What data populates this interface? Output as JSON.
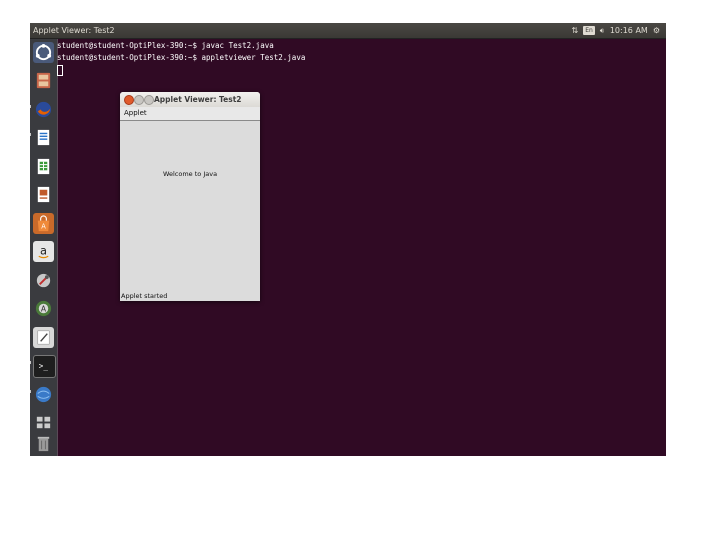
{
  "topbar": {
    "title": "Applet Viewer: Test2",
    "network_icon": "network-updown-icon",
    "keyboard_label": "En",
    "volume_icon": "speaker-volume-icon",
    "clock": "10:16 AM",
    "gear_icon": "gear-icon"
  },
  "launcher": {
    "items": [
      {
        "name": "dash-home",
        "icon": "ubuntu-logo-icon",
        "color": "#4a7bd6"
      },
      {
        "name": "files",
        "icon": "file-cabinet-icon",
        "color": "#c8664a"
      },
      {
        "name": "firefox",
        "icon": "firefox-icon",
        "color": "#e66000"
      },
      {
        "name": "writer",
        "icon": "document-icon",
        "color": "#2a74c9"
      },
      {
        "name": "calc",
        "icon": "spreadsheet-icon",
        "color": "#3a9a3a"
      },
      {
        "name": "impress",
        "icon": "presentation-icon",
        "color": "#c05a2a"
      },
      {
        "name": "software-center",
        "icon": "shopping-bag-icon",
        "color": "#e07b2a"
      },
      {
        "name": "amazon",
        "icon": "amazon-icon",
        "color": "#e6e6e6"
      },
      {
        "name": "system-settings",
        "icon": "wrench-icon",
        "color": "#5a6a8a"
      },
      {
        "name": "update-manager",
        "icon": "update-icon",
        "color": "#4a7a3a"
      },
      {
        "name": "text-editor",
        "icon": "pencil-icon",
        "color": "#d8d8d8"
      },
      {
        "name": "terminal",
        "icon": "terminal-icon",
        "color": "#2c2c2c"
      },
      {
        "name": "java",
        "icon": "globe-icon",
        "color": "#3a7ac8"
      },
      {
        "name": "workspaces",
        "icon": "workspace-icon",
        "color": "#888888"
      },
      {
        "name": "trash",
        "icon": "trash-icon",
        "color": "#9a9a9a"
      }
    ]
  },
  "terminal": {
    "lines": [
      "student@student-OptiPlex-390:~$ javac Test2.java",
      "student@student-OptiPlex-390:~$ appletviewer Test2.java"
    ]
  },
  "applet": {
    "title": "Applet Viewer: Test2",
    "menu_label": "Applet",
    "message": "Welcome to Java",
    "status": "Applet started"
  },
  "colors": {
    "desktop_bg": "#300a24",
    "panel_bg": "#3a3935",
    "launcher_bg": "#3a3b3f",
    "close_button": "#e05a2b"
  }
}
